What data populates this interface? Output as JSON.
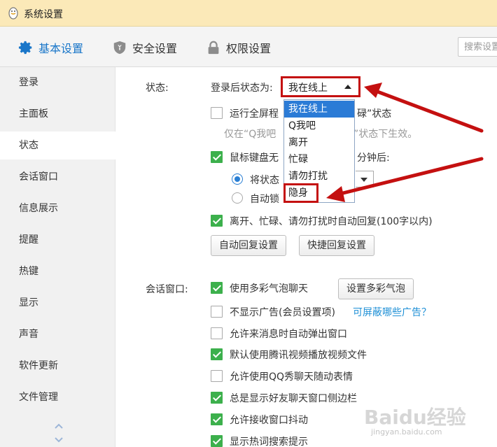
{
  "window": {
    "title": "系统设置"
  },
  "topnav": {
    "tabs": [
      {
        "label": "基本设置",
        "icon": "gear-icon",
        "active": true
      },
      {
        "label": "安全设置",
        "icon": "shield-icon",
        "active": false
      },
      {
        "label": "权限设置",
        "icon": "lock-icon",
        "active": false
      }
    ],
    "search_placeholder": "搜索设置"
  },
  "sidebar": {
    "items": [
      {
        "label": "登录"
      },
      {
        "label": "主面板"
      },
      {
        "label": "状态",
        "active": true
      },
      {
        "label": "会话窗口"
      },
      {
        "label": "信息展示"
      },
      {
        "label": "提醒"
      },
      {
        "label": "热键"
      },
      {
        "label": "显示"
      },
      {
        "label": "声音"
      },
      {
        "label": "软件更新"
      },
      {
        "label": "文件管理"
      }
    ]
  },
  "status_section": {
    "label": "状态:",
    "login_status_label": "登录后状态为:",
    "login_status_value": "我在线上",
    "fullscreen_prefix": "运行全屏程",
    "fullscreen_suffix": "碌”状态",
    "fullscreen_checked": false,
    "hint_prefix": "仅在“Q我吧",
    "hint_suffix": "”状态下生效。",
    "idle_prefix": "鼠标键盘无",
    "idle_suffix": "分钟后:",
    "idle_checked": true,
    "radio_set_status": "将状态",
    "radio_auto_lock": "自动锁",
    "auto_reply_label": "离开、忙碌、请勿打扰时自动回复(100字以内)",
    "auto_reply_checked": true,
    "btn_auto_reply": "自动回复设置",
    "btn_quick_reply": "快捷回复设置"
  },
  "dropdown": {
    "options": [
      "我在线上",
      "Q我吧",
      "离开",
      "忙碌",
      "请勿打扰",
      "隐身"
    ],
    "highlighted": "我在线上"
  },
  "chat_section": {
    "label": "会话窗口:",
    "btn_bubble": "设置多彩气泡",
    "ads_link": "可屏蔽哪些广告？",
    "options": [
      {
        "label": "使用多彩气泡聊天",
        "checked": true
      },
      {
        "label": "不显示广告(会员设置项)",
        "checked": false
      },
      {
        "label": "允许来消息时自动弹出窗口",
        "checked": false
      },
      {
        "label": "默认使用腾讯视频播放视频文件",
        "checked": true
      },
      {
        "label": "允许使用QQ秀聊天随动表情",
        "checked": false
      },
      {
        "label": "总是显示好友聊天窗口侧边栏",
        "checked": true
      },
      {
        "label": "允许接收窗口抖动",
        "checked": true
      },
      {
        "label": "显示热词搜索提示",
        "checked": true
      }
    ]
  },
  "watermark": {
    "text": "Baidu经验",
    "url": "jingyan.baidu.com"
  },
  "colors": {
    "accent": "#1976c9",
    "check_green": "#3cb04c",
    "highlight_red": "#c41010",
    "title_bar": "#fbe9b8"
  }
}
